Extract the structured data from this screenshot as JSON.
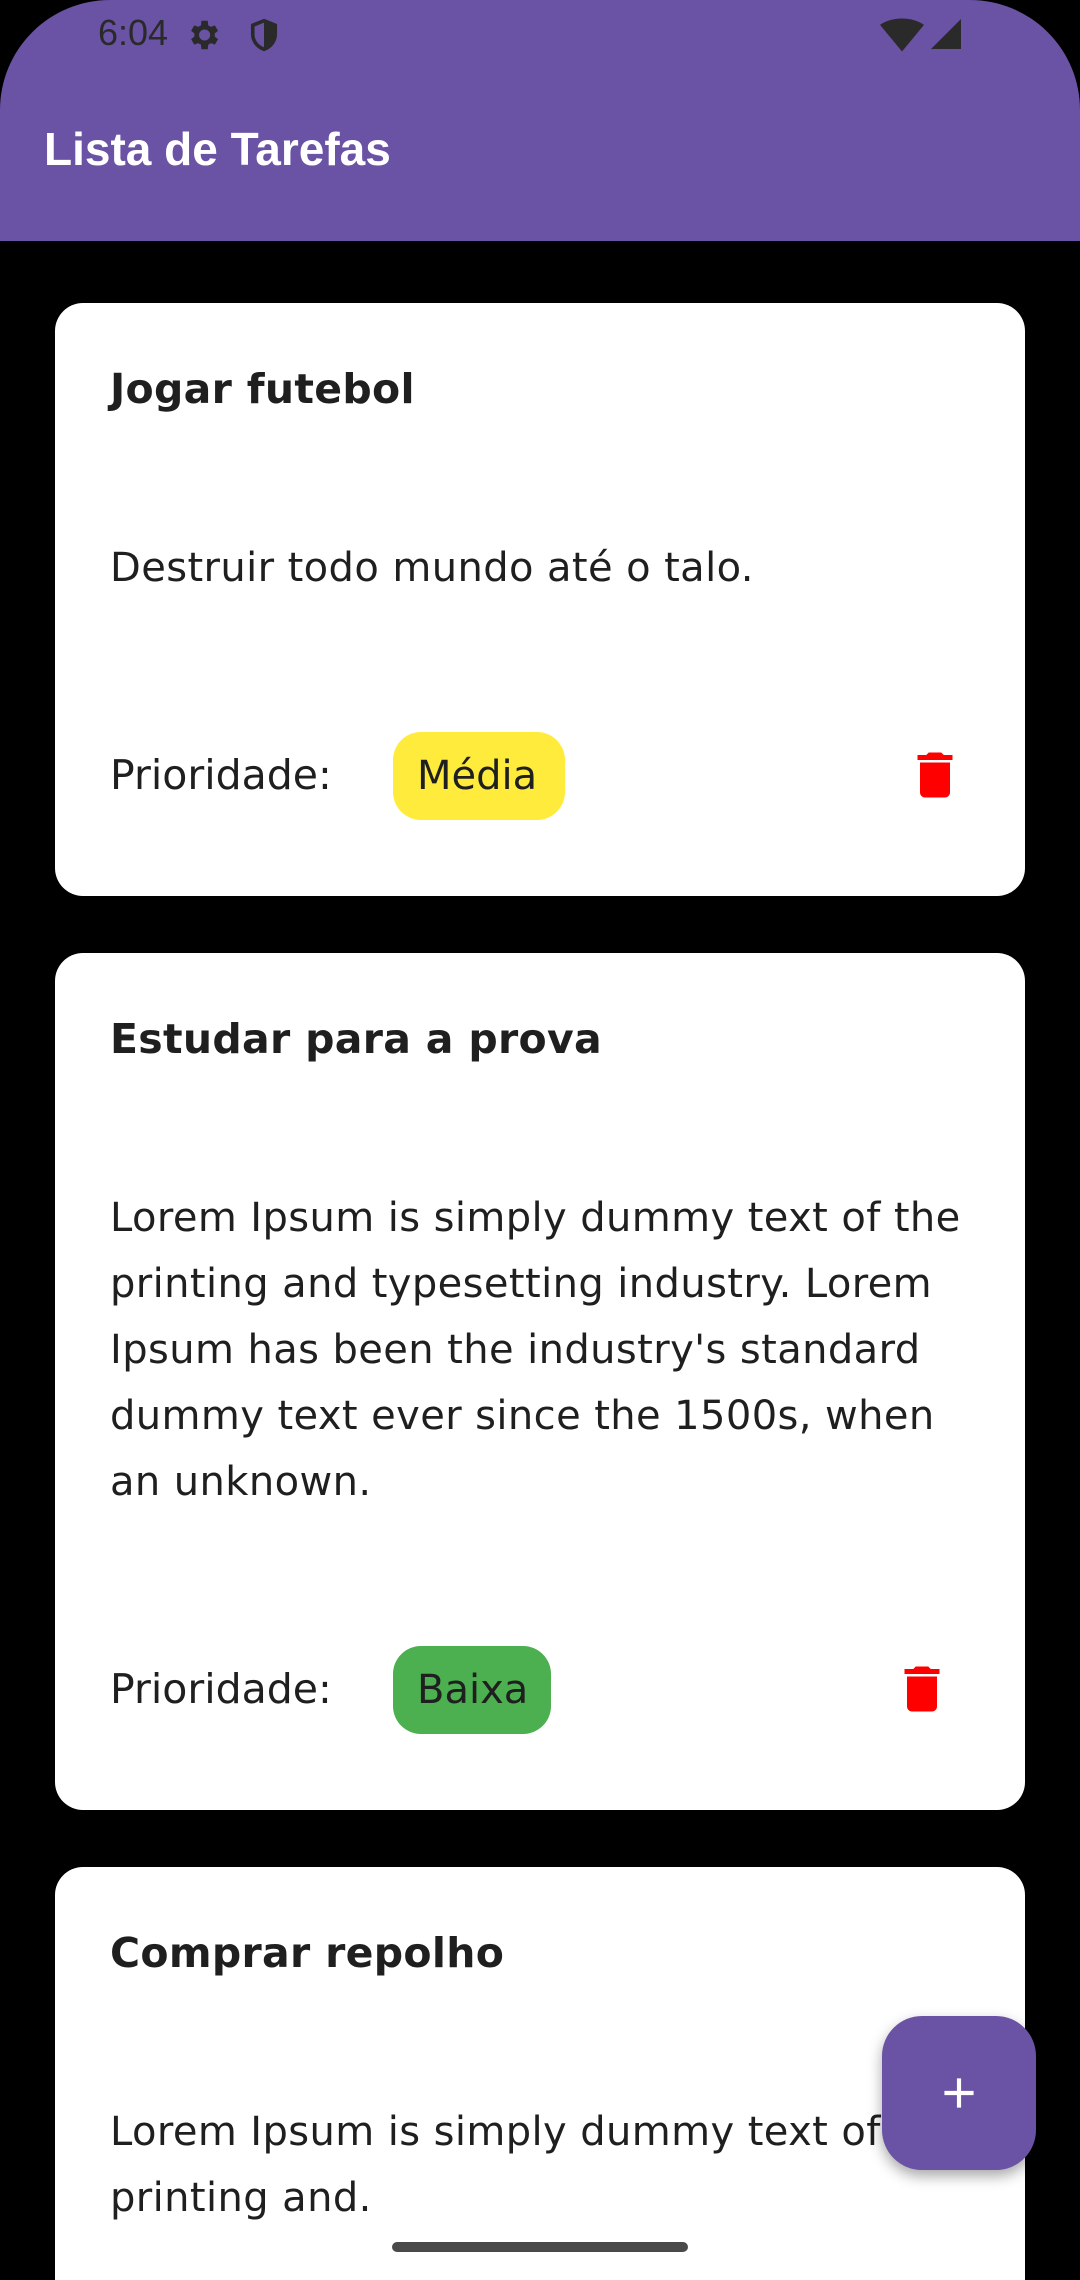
{
  "status_bar": {
    "time": "6:04",
    "icons": [
      "gear-icon",
      "shield-icon",
      "wifi-icon",
      "signal-icon"
    ]
  },
  "app_bar": {
    "title": "Lista de Tarefas",
    "color": "#6A52A4"
  },
  "tasks": [
    {
      "title": "Jogar futebol",
      "description": "Destruir todo mundo até o talo.",
      "priority_label": "Prioridade:",
      "priority": "Média",
      "priority_color": "#FFEB3B"
    },
    {
      "title": "Estudar para a prova",
      "description": "Lorem Ipsum is simply dummy text of the printing and typesetting industry. Lorem Ipsum has been the industry's standard dummy text ever since the 1500s, when an unknown.",
      "priority_label": "Prioridade:",
      "priority": "Baixa",
      "priority_color": "#4CAF50"
    },
    {
      "title": "Comprar repolho",
      "description": "Lorem Ipsum is simply dummy text of the printing and."
    }
  ],
  "fab": {
    "icon": "plus-icon"
  },
  "colors": {
    "delete": "#FF0000",
    "card": "#FFFFFF",
    "background": "#000000"
  }
}
